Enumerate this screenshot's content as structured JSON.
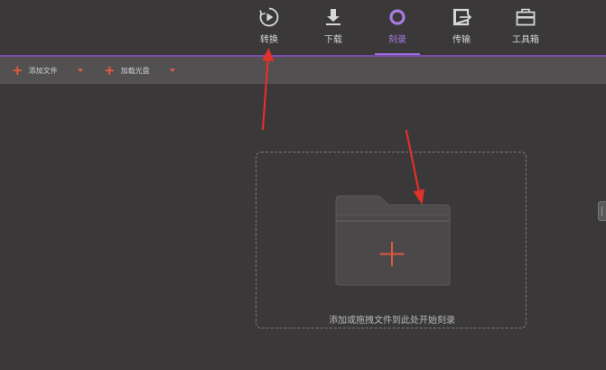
{
  "nav": {
    "items": [
      {
        "label": "转换",
        "icon": "convert-play-icon"
      },
      {
        "label": "下载",
        "icon": "download-icon"
      },
      {
        "label": "刻录",
        "icon": "burn-disc-icon",
        "active": true
      },
      {
        "label": "传输",
        "icon": "transfer-icon"
      },
      {
        "label": "工具箱",
        "icon": "toolbox-icon"
      }
    ],
    "active_color": "#a77be0"
  },
  "toolbar": {
    "add_file_label": "添加文件",
    "load_disc_label": "加载光盘",
    "accent_color": "#ea5b43"
  },
  "dropzone": {
    "hint": "添加或拖拽文件到此处开始刻录",
    "icon": "folder-add-icon"
  },
  "annotations": {
    "arrow_color": "#e0312a"
  }
}
